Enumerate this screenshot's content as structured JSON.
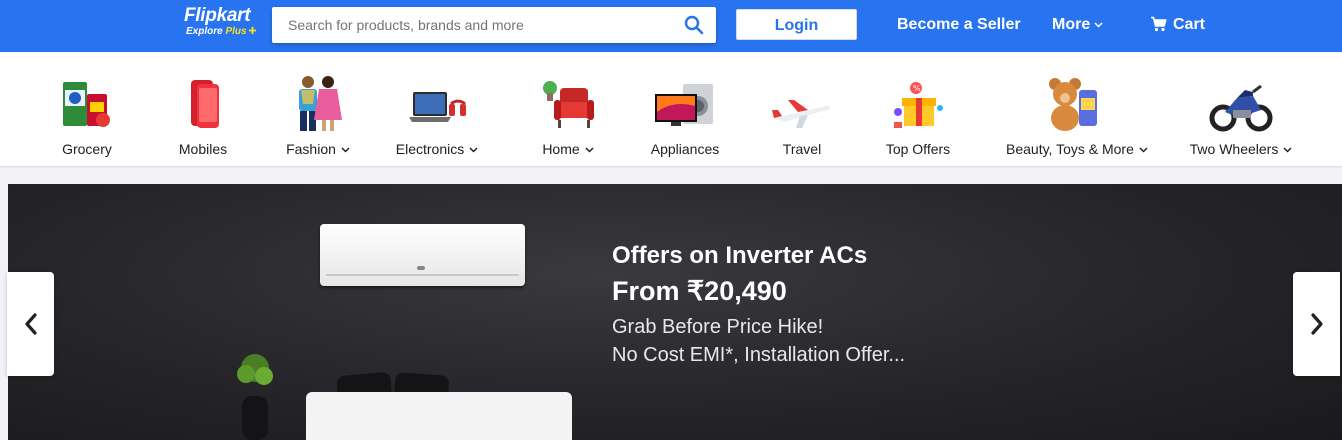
{
  "header": {
    "brand": "Flipkart",
    "tagline_prefix": "Explore",
    "tagline_plus": "Plus",
    "search_placeholder": "Search for products, brands and more",
    "login_label": "Login",
    "seller_label": "Become a Seller",
    "more_label": "More",
    "cart_label": "Cart",
    "colors": {
      "primary": "#2874f0",
      "plus_accent": "#ffe11b"
    }
  },
  "categories": [
    {
      "label": "Grocery",
      "has_dropdown": false,
      "icon": "grocery-icon"
    },
    {
      "label": "Mobiles",
      "has_dropdown": false,
      "icon": "mobile-icon"
    },
    {
      "label": "Fashion",
      "has_dropdown": true,
      "icon": "fashion-icon"
    },
    {
      "label": "Electronics",
      "has_dropdown": true,
      "icon": "laptop-icon"
    },
    {
      "label": "Home",
      "has_dropdown": true,
      "icon": "armchair-icon"
    },
    {
      "label": "Appliances",
      "has_dropdown": false,
      "icon": "tv-washer-icon"
    },
    {
      "label": "Travel",
      "has_dropdown": false,
      "icon": "airplane-icon"
    },
    {
      "label": "Top Offers",
      "has_dropdown": false,
      "icon": "gift-icon"
    },
    {
      "label": "Beauty, Toys & More",
      "has_dropdown": true,
      "icon": "teddy-bear-icon"
    },
    {
      "label": "Two Wheelers",
      "has_dropdown": true,
      "icon": "motorcycle-icon"
    }
  ],
  "banner": {
    "title": "Offers on Inverter ACs",
    "price": "From ₹20,490",
    "line1": "Grab Before Price Hike!",
    "line2": "No Cost EMI*, Installation Offer..."
  }
}
